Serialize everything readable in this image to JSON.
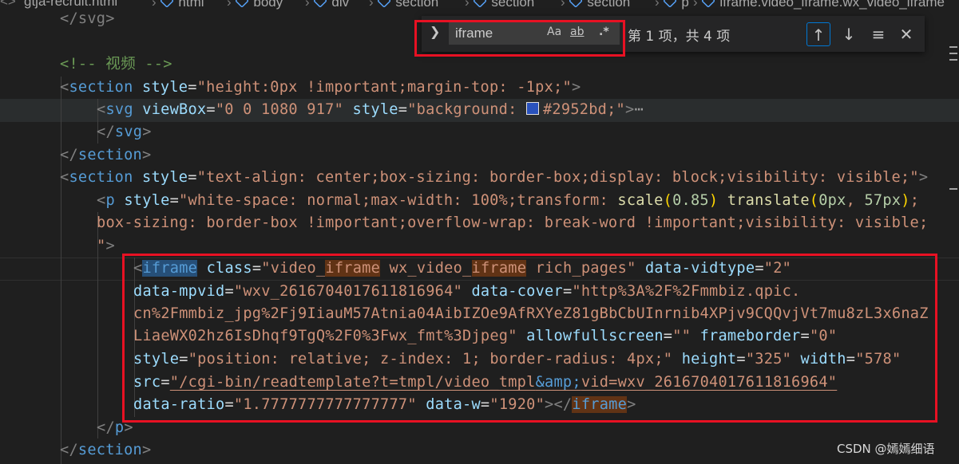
{
  "breadcrumb": {
    "items": [
      "gtja-recruit.html",
      "html",
      "body",
      "div",
      "section",
      "section",
      "section",
      "p",
      "iframe.video_iframe.wx_video_iframe"
    ]
  },
  "find_widget": {
    "query": "iframe",
    "match_case_label": "Aa",
    "whole_word_label": "ab",
    "regex_label": ".*",
    "result_text": "第 1 项，共 4 项"
  },
  "code": {
    "l1_close_svg": "</svg>",
    "l2_comment": "<!-- 视频 -->",
    "l3": {
      "tag": "section",
      "attr": "style",
      "value": "\"height:0px !important;margin-top: -1px;\""
    },
    "l4": {
      "tag": "svg",
      "attr1": "viewBox",
      "val1": "\"0 0 1080 917\"",
      "attr2": "style",
      "val2_pre": "\"background: ",
      "color": "#2952bd",
      "val2_post": ";\"",
      "fold": "⋯"
    },
    "l5_close": "svg",
    "l6_close": "section",
    "l7": {
      "tag": "section",
      "attr": "style",
      "value": "\"text-align: center;box-sizing: border-box;display: block;visibility: visible;\""
    },
    "l8": {
      "tag": "p",
      "attr": "style",
      "val_a": "\"white-space: normal;max-width: 100%;transform: ",
      "fn1": "scale",
      "num1": "0.85",
      "fn2": "translate",
      "num2a": "0px",
      "num2b": "57px",
      "val_b": ";"
    },
    "l9": "box-sizing: border-box !important;overflow-wrap: break-word !important;visibility: visible;",
    "l10": "\">",
    "l11": {
      "tag": "iframe",
      "class_attr": "class",
      "class_a": "\"video_",
      "class_m1": "iframe",
      "class_b": " wx_video_",
      "class_m2": "iframe",
      "class_c": " rich_pages\"",
      "attr2": "data-vidtype",
      "val2": "\"2\""
    },
    "l12": {
      "attr": "data-mpvid",
      "val": "\"wxv_2616704017611816964\"",
      "attr2": "data-cover",
      "val2": "\"http%3A%2F%2Fmmbiz.qpic."
    },
    "l13": "cn%2Fmmbiz_jpg%2Fj9IiauM57Atnia04AibIZOe9AfRXYeZ81gBbCbUInrnib4XPjv9CQQvjVt7mu8zL3x6naZ",
    "l14": {
      "val": "LiaeWX02hz6IsDhqf9TgQ%2F0%3Fwx_fmt%3Djpeg\"",
      "attr": "allowfullscreen",
      "val2": "\"\"",
      "attr2": "frameborder",
      "val3": "\"0\""
    },
    "l15": {
      "attr": "style",
      "val": "\"position: relative; z-index: 1; border-radius: 4px;\"",
      "attr2": "height",
      "val2": "\"325\"",
      "attr3": "width",
      "val3": "\"578\""
    },
    "l16": {
      "attr": "src",
      "val_a": "\"/cgi-bin/readtemplate?t=tmpl/video_tmpl",
      "amp": "&amp;",
      "val_b": "vid=wxv_2616704017611816964\""
    },
    "l17": {
      "attr": "data-ratio",
      "val": "\"1.7777777777777777\"",
      "attr2": "data-w",
      "val2": "\"1920\"",
      "close_tag": "iframe"
    },
    "l18_close": "p",
    "l19_close": "section"
  },
  "watermark": "CSDN @嫣嫣细语",
  "colors": {
    "annotation": "#e81123",
    "swatch": "#2952bd",
    "editor_bg": "#1f1f1f"
  }
}
